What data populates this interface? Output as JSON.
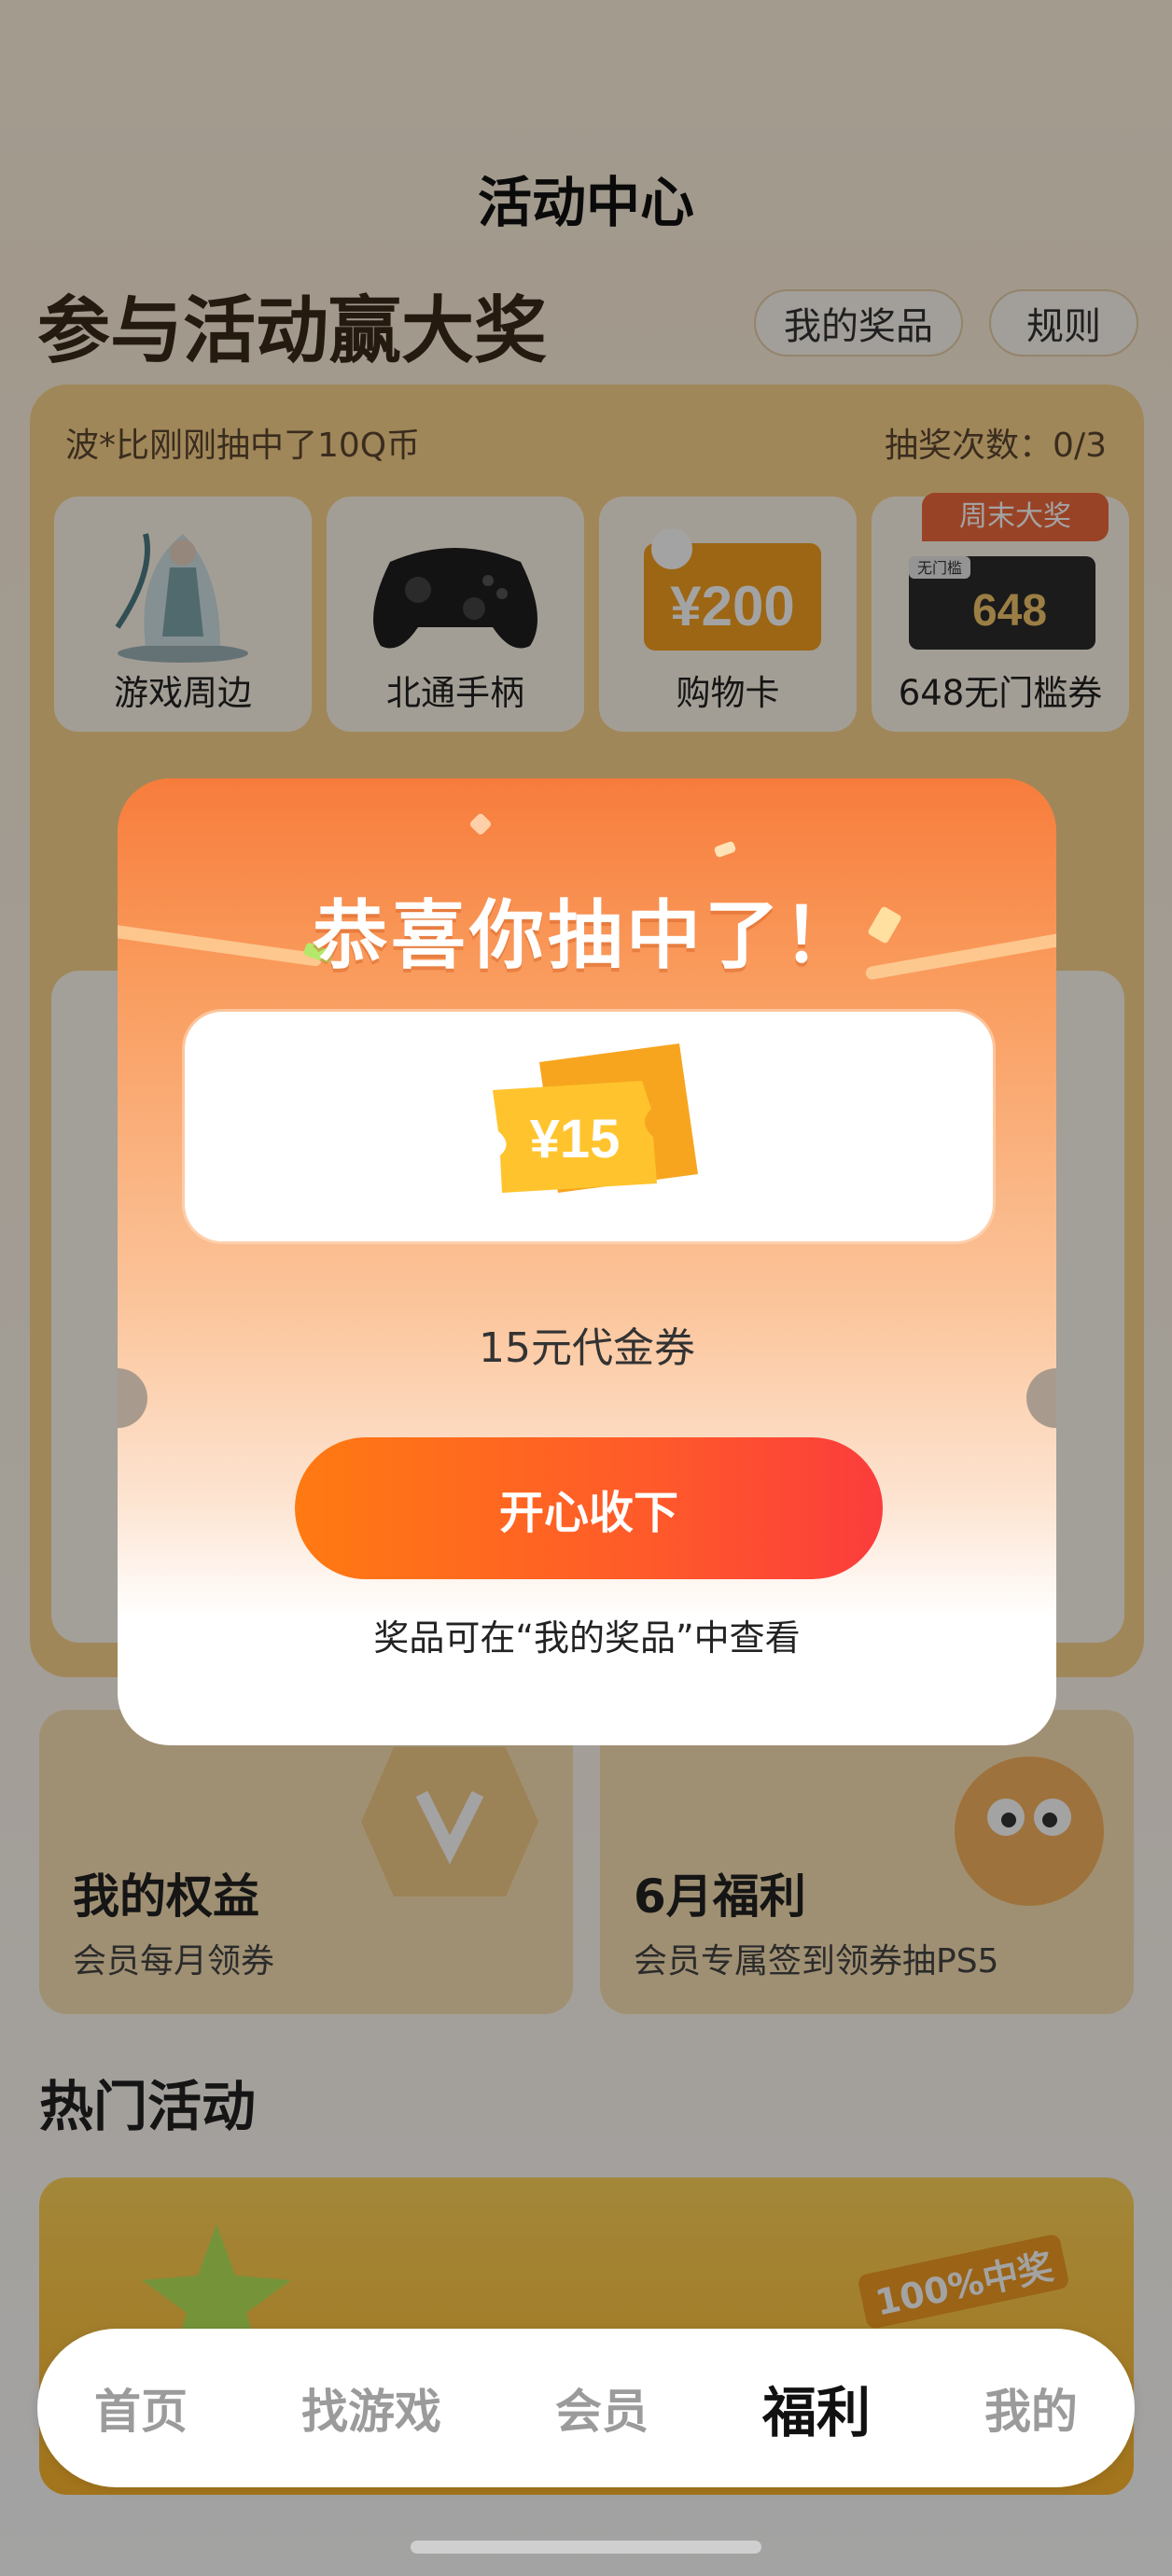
{
  "header": {
    "title": "活动中心"
  },
  "lottery": {
    "headline": "参与活动赢大奖",
    "my_prizes_label": "我的奖品",
    "rules_label": "规则",
    "ticker": "波*比刚刚抽中了10Q币",
    "draw_count_label": "抽奖次数：0/3",
    "weekend_tag": "周末大奖",
    "prizes": [
      {
        "label": "游戏周边",
        "icon": "figure-icon"
      },
      {
        "label": "北通手柄",
        "icon": "gamepad-icon"
      },
      {
        "label": "购物卡",
        "icon": "shopping-card-icon",
        "card_value": "¥200"
      },
      {
        "label": "648无门槛券",
        "icon": "voucher-icon",
        "card_value": "648",
        "card_tag": "无门槛"
      }
    ]
  },
  "benefits": [
    {
      "title": "我的权益",
      "subtitle": "会员每月领券"
    },
    {
      "title": "6月福利",
      "subtitle": "会员专属签到领券抽PS5"
    }
  ],
  "hot": {
    "title": "热门活动",
    "banner_tag": "100%中奖"
  },
  "modal": {
    "title": "恭喜你抽中了！",
    "coupon_value": "¥15",
    "prize_name": "15元代金券",
    "accept_label": "开心收下",
    "tip": "奖品可在“我的奖品”中查看"
  },
  "nav": {
    "items": [
      {
        "label": "首页",
        "active": false
      },
      {
        "label": "找游戏",
        "active": false
      },
      {
        "label": "会员",
        "active": false
      },
      {
        "label": "福利",
        "active": true
      },
      {
        "label": "我的",
        "active": false
      }
    ]
  },
  "colors": {
    "accent": "#ff6a1f",
    "lottery_bg": "#fbd38c",
    "modal_top": "#f77c3c"
  }
}
